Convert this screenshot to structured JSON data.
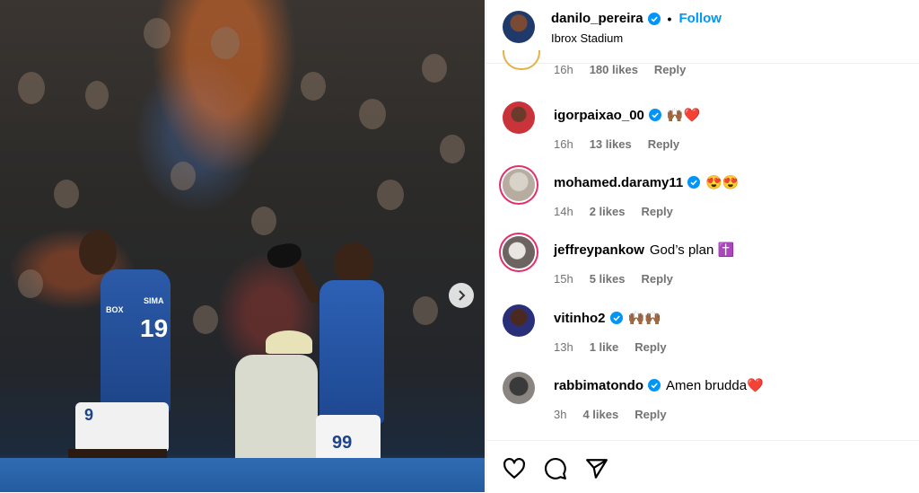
{
  "post": {
    "username": "danilo_pereira",
    "follow_label": "Follow",
    "separator": "•",
    "location": "Ibrox Stadium"
  },
  "photo": {
    "jersey_left_number": "19",
    "jersey_left_name": "SIMA",
    "shorts_left_number": "9",
    "shorts_right_number": "99",
    "sleeve_text": "BOX"
  },
  "top_partial": {
    "time": "16h",
    "likes": "180 likes",
    "reply": "Reply"
  },
  "comments": [
    {
      "username": "igorpaixao_00",
      "text": "🙌🏾❤️",
      "time": "16h",
      "likes": "13 likes",
      "reply": "Reply"
    },
    {
      "username": "mohamed.daramy11",
      "text": "😍😍",
      "time": "14h",
      "likes": "2 likes",
      "reply": "Reply"
    },
    {
      "username": "jeffreypankow",
      "text": "God’s plan ✝️",
      "time": "15h",
      "likes": "5 likes",
      "reply": "Reply"
    },
    {
      "username": "vitinho2",
      "text": "🙌🏾🙌🏾",
      "time": "13h",
      "likes": "1 like",
      "reply": "Reply"
    },
    {
      "username": "rabbimatondo",
      "text": "Amen brudda❤️",
      "time": "3h",
      "likes": "4 likes",
      "reply": "Reply"
    }
  ],
  "colors": {
    "accent": "#0095f6",
    "verified": "#0095f6",
    "muted": "#737373",
    "story_ring": "#e1306c"
  },
  "icons": [
    "verified-badge-icon",
    "heart-icon",
    "comment-icon",
    "share-icon",
    "chevron-right-icon"
  ]
}
